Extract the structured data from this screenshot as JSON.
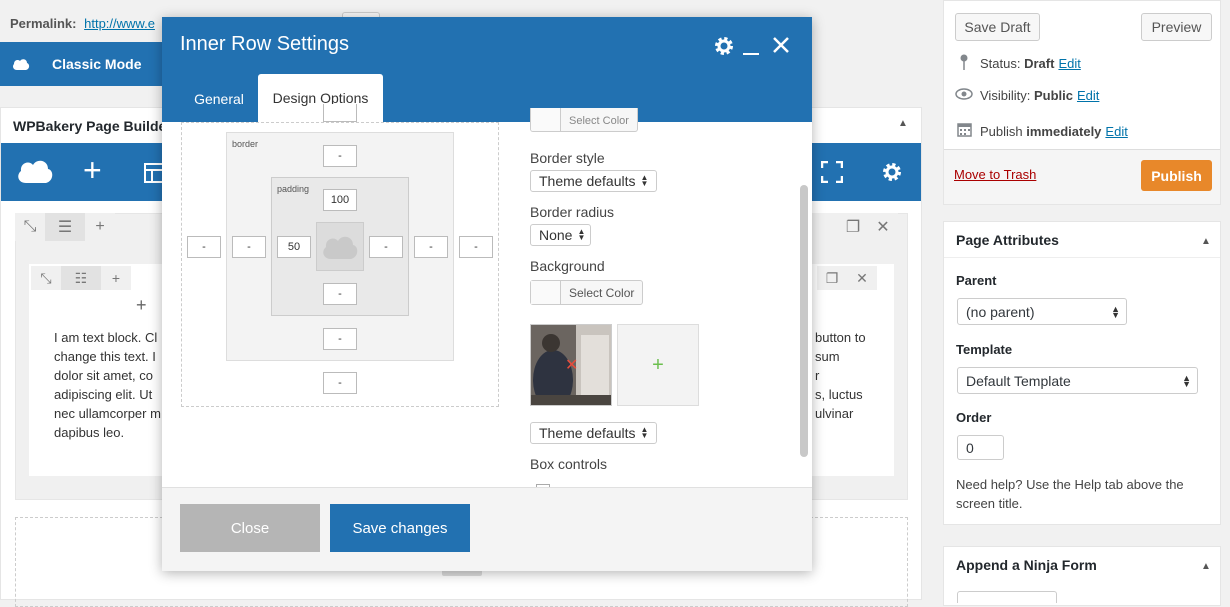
{
  "editor": {
    "permalink_label": "Permalink:",
    "permalink_url": "http://www.e",
    "classic_mode": "Classic Mode",
    "wpbakery_title": "WPBakery Page Builder",
    "text_block_left": "I am text block. Click edit button to change this text. Lorem ipsum dolor sit amet, consectetur adipiscing elit. Ut elit tellus, luctus nec ullamcorper mattis, pulvinar dapibus leo.",
    "text_left_lines": [
      "I am text block. Cl",
      "change this text. I",
      "dolor sit amet, co",
      "adipiscing elit. Ut",
      "nec ullamcorper m",
      "dapibus leo."
    ],
    "text_right_lines": [
      "button to",
      "sum",
      "r",
      "s, luctus",
      "ulvinar"
    ]
  },
  "publish": {
    "save_draft": "Save Draft",
    "preview": "Preview",
    "status_label": "Status:",
    "status_value": "Draft",
    "visibility_label": "Visibility:",
    "visibility_value": "Public",
    "publish_label": "Publish",
    "publish_value": "immediately",
    "edit": "Edit",
    "move_to_trash": "Move to Trash",
    "publish_button": "Publish"
  },
  "page_attributes": {
    "title": "Page Attributes",
    "parent_label": "Parent",
    "parent_value": "(no parent)",
    "template_label": "Template",
    "template_value": "Default Template",
    "order_label": "Order",
    "order_value": "0",
    "help_text": "Need help? Use the Help tab above the screen title."
  },
  "ninja": {
    "title": "Append a Ninja Form"
  },
  "modal": {
    "title": "Inner Row Settings",
    "tabs": [
      "General",
      "Design Options"
    ],
    "close_button": "Close",
    "save_button": "Save changes",
    "box": {
      "border_label": "border",
      "padding_label": "padding",
      "padding_top": "100",
      "padding_left": "50",
      "empty": "-"
    },
    "options": {
      "select_color": "Select Color",
      "border_style_label": "Border style",
      "border_style_value": "Theme defaults",
      "border_radius_label": "Border radius",
      "border_radius_value": "None",
      "background_label": "Background",
      "background_select_color": "Select Color",
      "bg_style_value": "Theme defaults",
      "box_controls_label": "Box controls"
    }
  },
  "colors": {
    "wp_blue": "#2271b1",
    "publish_orange": "#e8882a",
    "trash_red": "#aa0000"
  }
}
